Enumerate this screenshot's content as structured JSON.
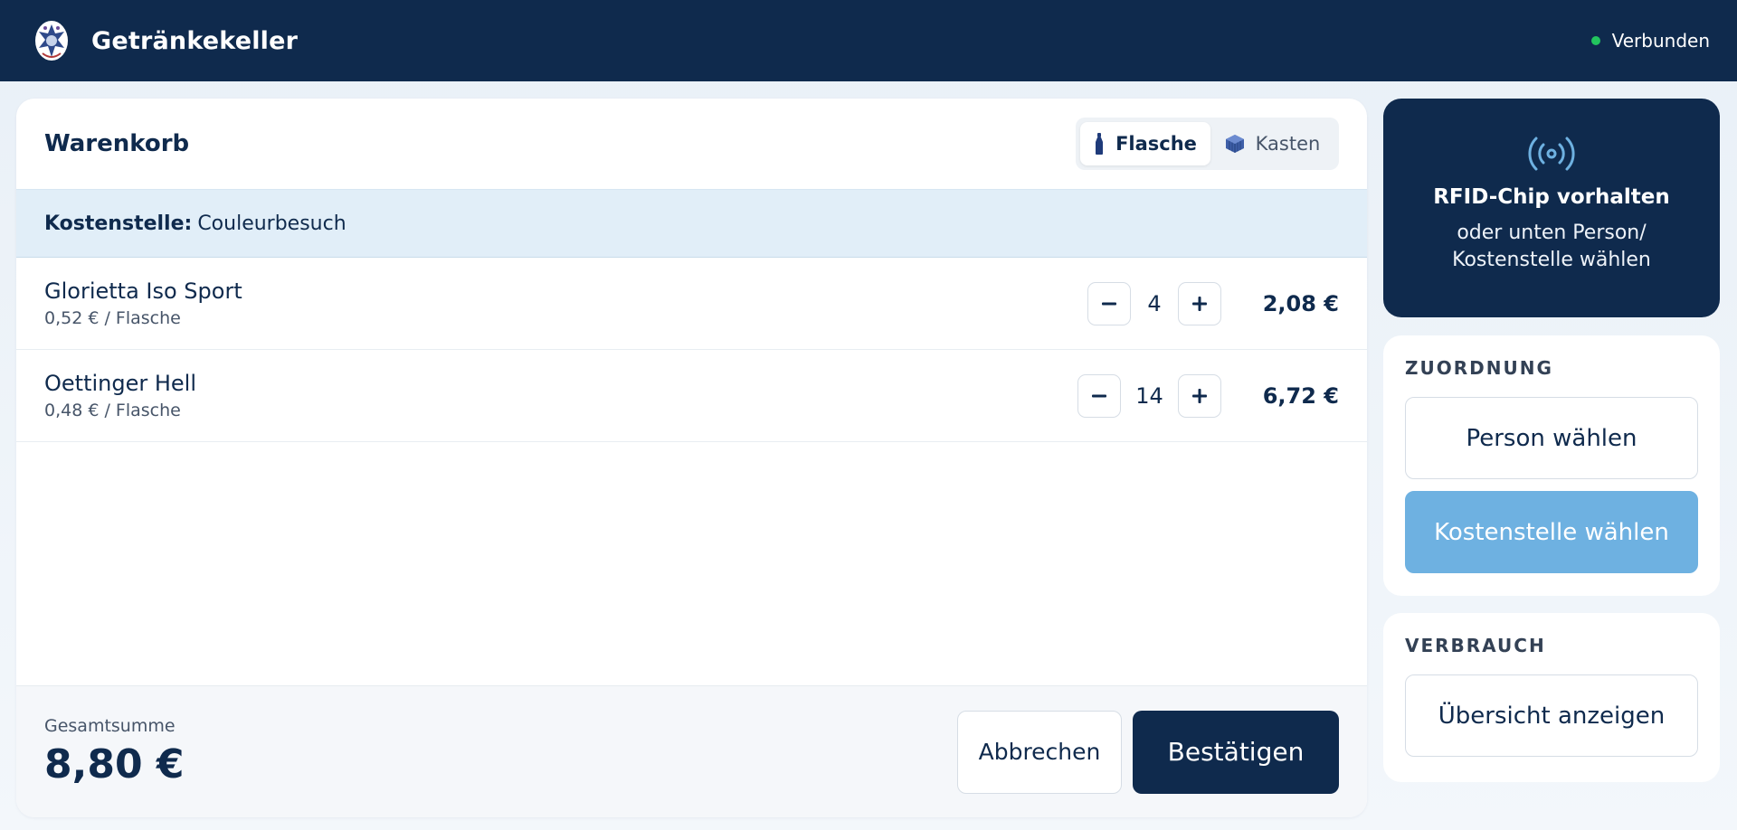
{
  "header": {
    "app_title": "Getränkekeller",
    "status_label": "Verbunden",
    "status_color": "#22c55e"
  },
  "cart": {
    "title": "Warenkorb",
    "toggle": {
      "bottle_label": "Flasche",
      "crate_label": "Kasten",
      "selected": "Flasche"
    },
    "cost_center": {
      "label": "Kostenstelle:",
      "value": "Couleurbesuch"
    },
    "items": [
      {
        "name": "Glorietta Iso Sport",
        "unit_price": "0,52 € / Flasche",
        "quantity": "4",
        "total": "2,08 €"
      },
      {
        "name": "Oettinger Hell",
        "unit_price": "0,48 € / Flasche",
        "quantity": "14",
        "total": "6,72 €"
      }
    ],
    "footer": {
      "sum_label": "Gesamtsumme",
      "sum_value": "8,80 €",
      "cancel_label": "Abbrechen",
      "confirm_label": "Bestätigen"
    }
  },
  "rfid": {
    "title": "RFID-Chip vorhalten",
    "subtitle_line1": "oder unten Person/",
    "subtitle_line2": "Kostenstelle wählen",
    "icon": "rfid-signal-icon"
  },
  "assignment": {
    "title": "ZUORDNUNG",
    "person_label": "Person wählen",
    "cost_center_label": "Kostenstelle wählen"
  },
  "consumption": {
    "title": "VERBRAUCH",
    "overview_label": "Übersicht anzeigen"
  },
  "colors": {
    "navy": "#0f2a4d",
    "accent_blue": "#6eb1e1",
    "cost_bar": "#e1eef8"
  }
}
